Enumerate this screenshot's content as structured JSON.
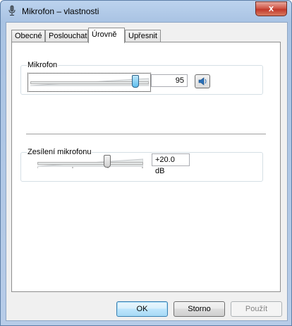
{
  "window": {
    "title": "Mikrofon – vlastnosti",
    "close_glyph": "x"
  },
  "tabs": [
    {
      "label": "Obecné",
      "active": false
    },
    {
      "label": "Poslouchat",
      "active": false
    },
    {
      "label": "Úrovně",
      "active": true
    },
    {
      "label": "Upřesnit",
      "active": false
    }
  ],
  "microphone": {
    "label": "Mikrofon",
    "value": "95",
    "level": 95,
    "speaker_icon": "speaker-icon"
  },
  "boost": {
    "label": "Zesílení mikrofonu",
    "value": "+20.0 dB",
    "level_fraction": 0.67
  },
  "buttons": {
    "ok": "OK",
    "cancel": "Storno",
    "apply": "Použít"
  },
  "colors": {
    "titlebar": "#b9d1ea",
    "close": "#c7402f",
    "thumb_active": "#5fbfee",
    "default_button": "#bee6fd"
  }
}
